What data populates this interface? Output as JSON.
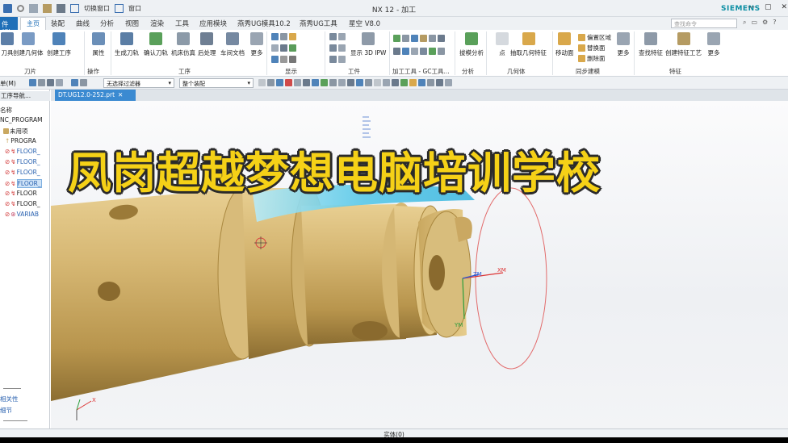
{
  "titlebar": {
    "window_title": "NX 12 - 加工",
    "brand": "SIEMENS",
    "quick_access_label": "切换窗口",
    "window_label": "窗口"
  },
  "menubar": {
    "file": "件(F)",
    "tabs": [
      "主页",
      "装配",
      "曲线",
      "分析",
      "视图",
      "渲染",
      "工具",
      "应用模块",
      "燕秀UG模具10.2",
      "燕秀UG工具",
      "星空 V8.0"
    ],
    "search_placeholder": "查找命令"
  },
  "ribbon": {
    "buttons": [
      "刀具",
      "创建几何体",
      "创建工序",
      "属性",
      "生成刀轨",
      "确认刀轨",
      "机床仿真",
      "后处理",
      "车间文档",
      "更多",
      "显示 3D IPW",
      "拔模分析",
      "点",
      "抽取几何特征",
      "移动面",
      "更多",
      "查找特征",
      "创建特征工艺",
      "更多"
    ],
    "small_items": [
      "偏置区域",
      "替换面",
      "删除面"
    ],
    "groups": [
      "刀片",
      "操作",
      "工序",
      "显示",
      "工件",
      "加工工具 - GC工具...",
      "分析",
      "几何体",
      "同步建模",
      "特征"
    ]
  },
  "toolbar2": {
    "menu": "单(M)",
    "filter": "无选择过滤器",
    "assembly": "整个装配"
  },
  "navigator": {
    "title": "工序导航...",
    "column": "名称",
    "root": "NC_PROGRAM",
    "nodes": [
      "未用项",
      "PROGRA",
      "FLOOR_",
      "FLOOR_",
      "FLOOR_",
      "FLOOR_",
      "FLOOR",
      "FLOOR_",
      "VARIAB"
    ],
    "bottom": [
      "相关性",
      "细节"
    ]
  },
  "document_tab": "DT.UG12.0-252.prt",
  "viewport": {
    "overlay_text": "凤岗超越梦想电脑培训学校",
    "axis_labels": [
      "XM",
      "YM",
      "ZM"
    ],
    "triad_label": "X"
  },
  "status": "实体(0)",
  "colors": {
    "part": "#c9a860",
    "toolpath": "#58c8e8",
    "overlay": "#f5d117",
    "accent": "#1f6fb8"
  }
}
